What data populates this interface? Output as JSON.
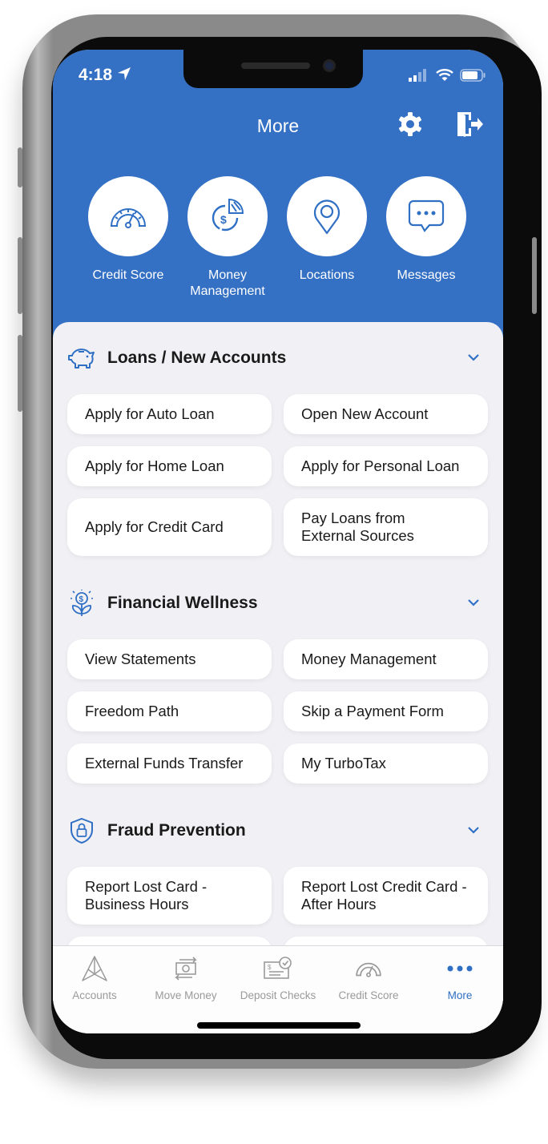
{
  "status_bar": {
    "time": "4:18"
  },
  "header": {
    "title": "More"
  },
  "quick_actions": [
    {
      "label": "Credit Score",
      "icon": "gauge-icon"
    },
    {
      "label": "Money Management",
      "icon": "money-chart-icon"
    },
    {
      "label": "Locations",
      "icon": "map-pin-icon"
    },
    {
      "label": "Messages",
      "icon": "chat-bubble-icon"
    }
  ],
  "sections": [
    {
      "title": "Loans / New Accounts",
      "icon": "piggy-bank-icon",
      "items": [
        "Apply for Auto Loan",
        "Open New Account",
        "Apply for Home Loan",
        "Apply for Personal Loan",
        "Apply for Credit Card",
        "Pay Loans from External Sources"
      ]
    },
    {
      "title": "Financial Wellness",
      "icon": "money-plant-icon",
      "items": [
        "View Statements",
        "Money Management",
        "Freedom Path",
        "Skip a Payment Form",
        "External Funds Transfer",
        "My TurboTax"
      ]
    },
    {
      "title": "Fraud Prevention",
      "icon": "shield-lock-icon",
      "items": [
        "Report Lost Card - Business Hours",
        "Report Lost Credit Card - After Hours"
      ]
    }
  ],
  "tabs": [
    {
      "label": "Accounts",
      "icon": "accounts-logo-icon"
    },
    {
      "label": "Move Money",
      "icon": "transfer-money-icon"
    },
    {
      "label": "Deposit Checks",
      "icon": "check-deposit-icon"
    },
    {
      "label": "Credit Score",
      "icon": "gauge-icon"
    },
    {
      "label": "More",
      "icon": "more-dots-icon",
      "active": true
    }
  ],
  "colors": {
    "brand": "#3470C4",
    "accent": "#2F6FC4",
    "background": "#F1F1F5"
  }
}
